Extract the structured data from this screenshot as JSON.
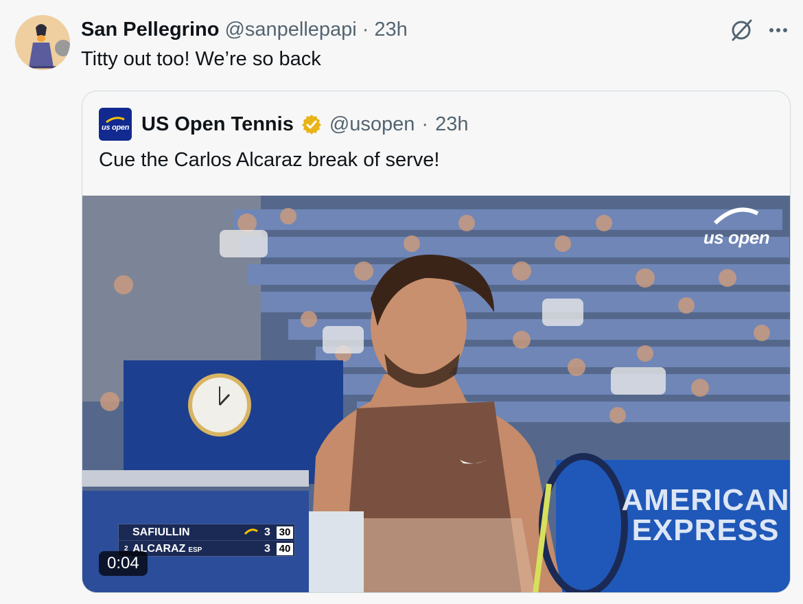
{
  "post": {
    "author_name": "San Pellegrino",
    "handle": "@sanpellepapi",
    "separator": "·",
    "time": "23h",
    "text": "Titty out too! We’re so back",
    "icons": [
      "grok-icon",
      "more-icon"
    ]
  },
  "quote": {
    "author_name": "US Open Tennis",
    "handle": "@usopen",
    "separator": "·",
    "time": "23h",
    "text": "Cue the Carlos Alcaraz break of serve!",
    "logo_text": "us open",
    "verified_color": "#e8b419"
  },
  "video": {
    "timestamp": "0:04",
    "watermark": "us open",
    "sponsor_line1": "AMERICAN",
    "sponsor_line2": "EXPRESS",
    "scoreboard": {
      "rows": [
        {
          "seed": "",
          "name": "SAFIULLIN",
          "country": "",
          "games": "3",
          "points": "30"
        },
        {
          "seed": "2",
          "name": "ALCARAZ",
          "country": "ESP",
          "games": "3",
          "points": "40"
        }
      ]
    }
  },
  "colors": {
    "text_primary": "#0f1419",
    "text_secondary": "#536471",
    "border": "#cfd9de",
    "background": "#f7f7f7",
    "usopen_blue": "#12298f"
  }
}
